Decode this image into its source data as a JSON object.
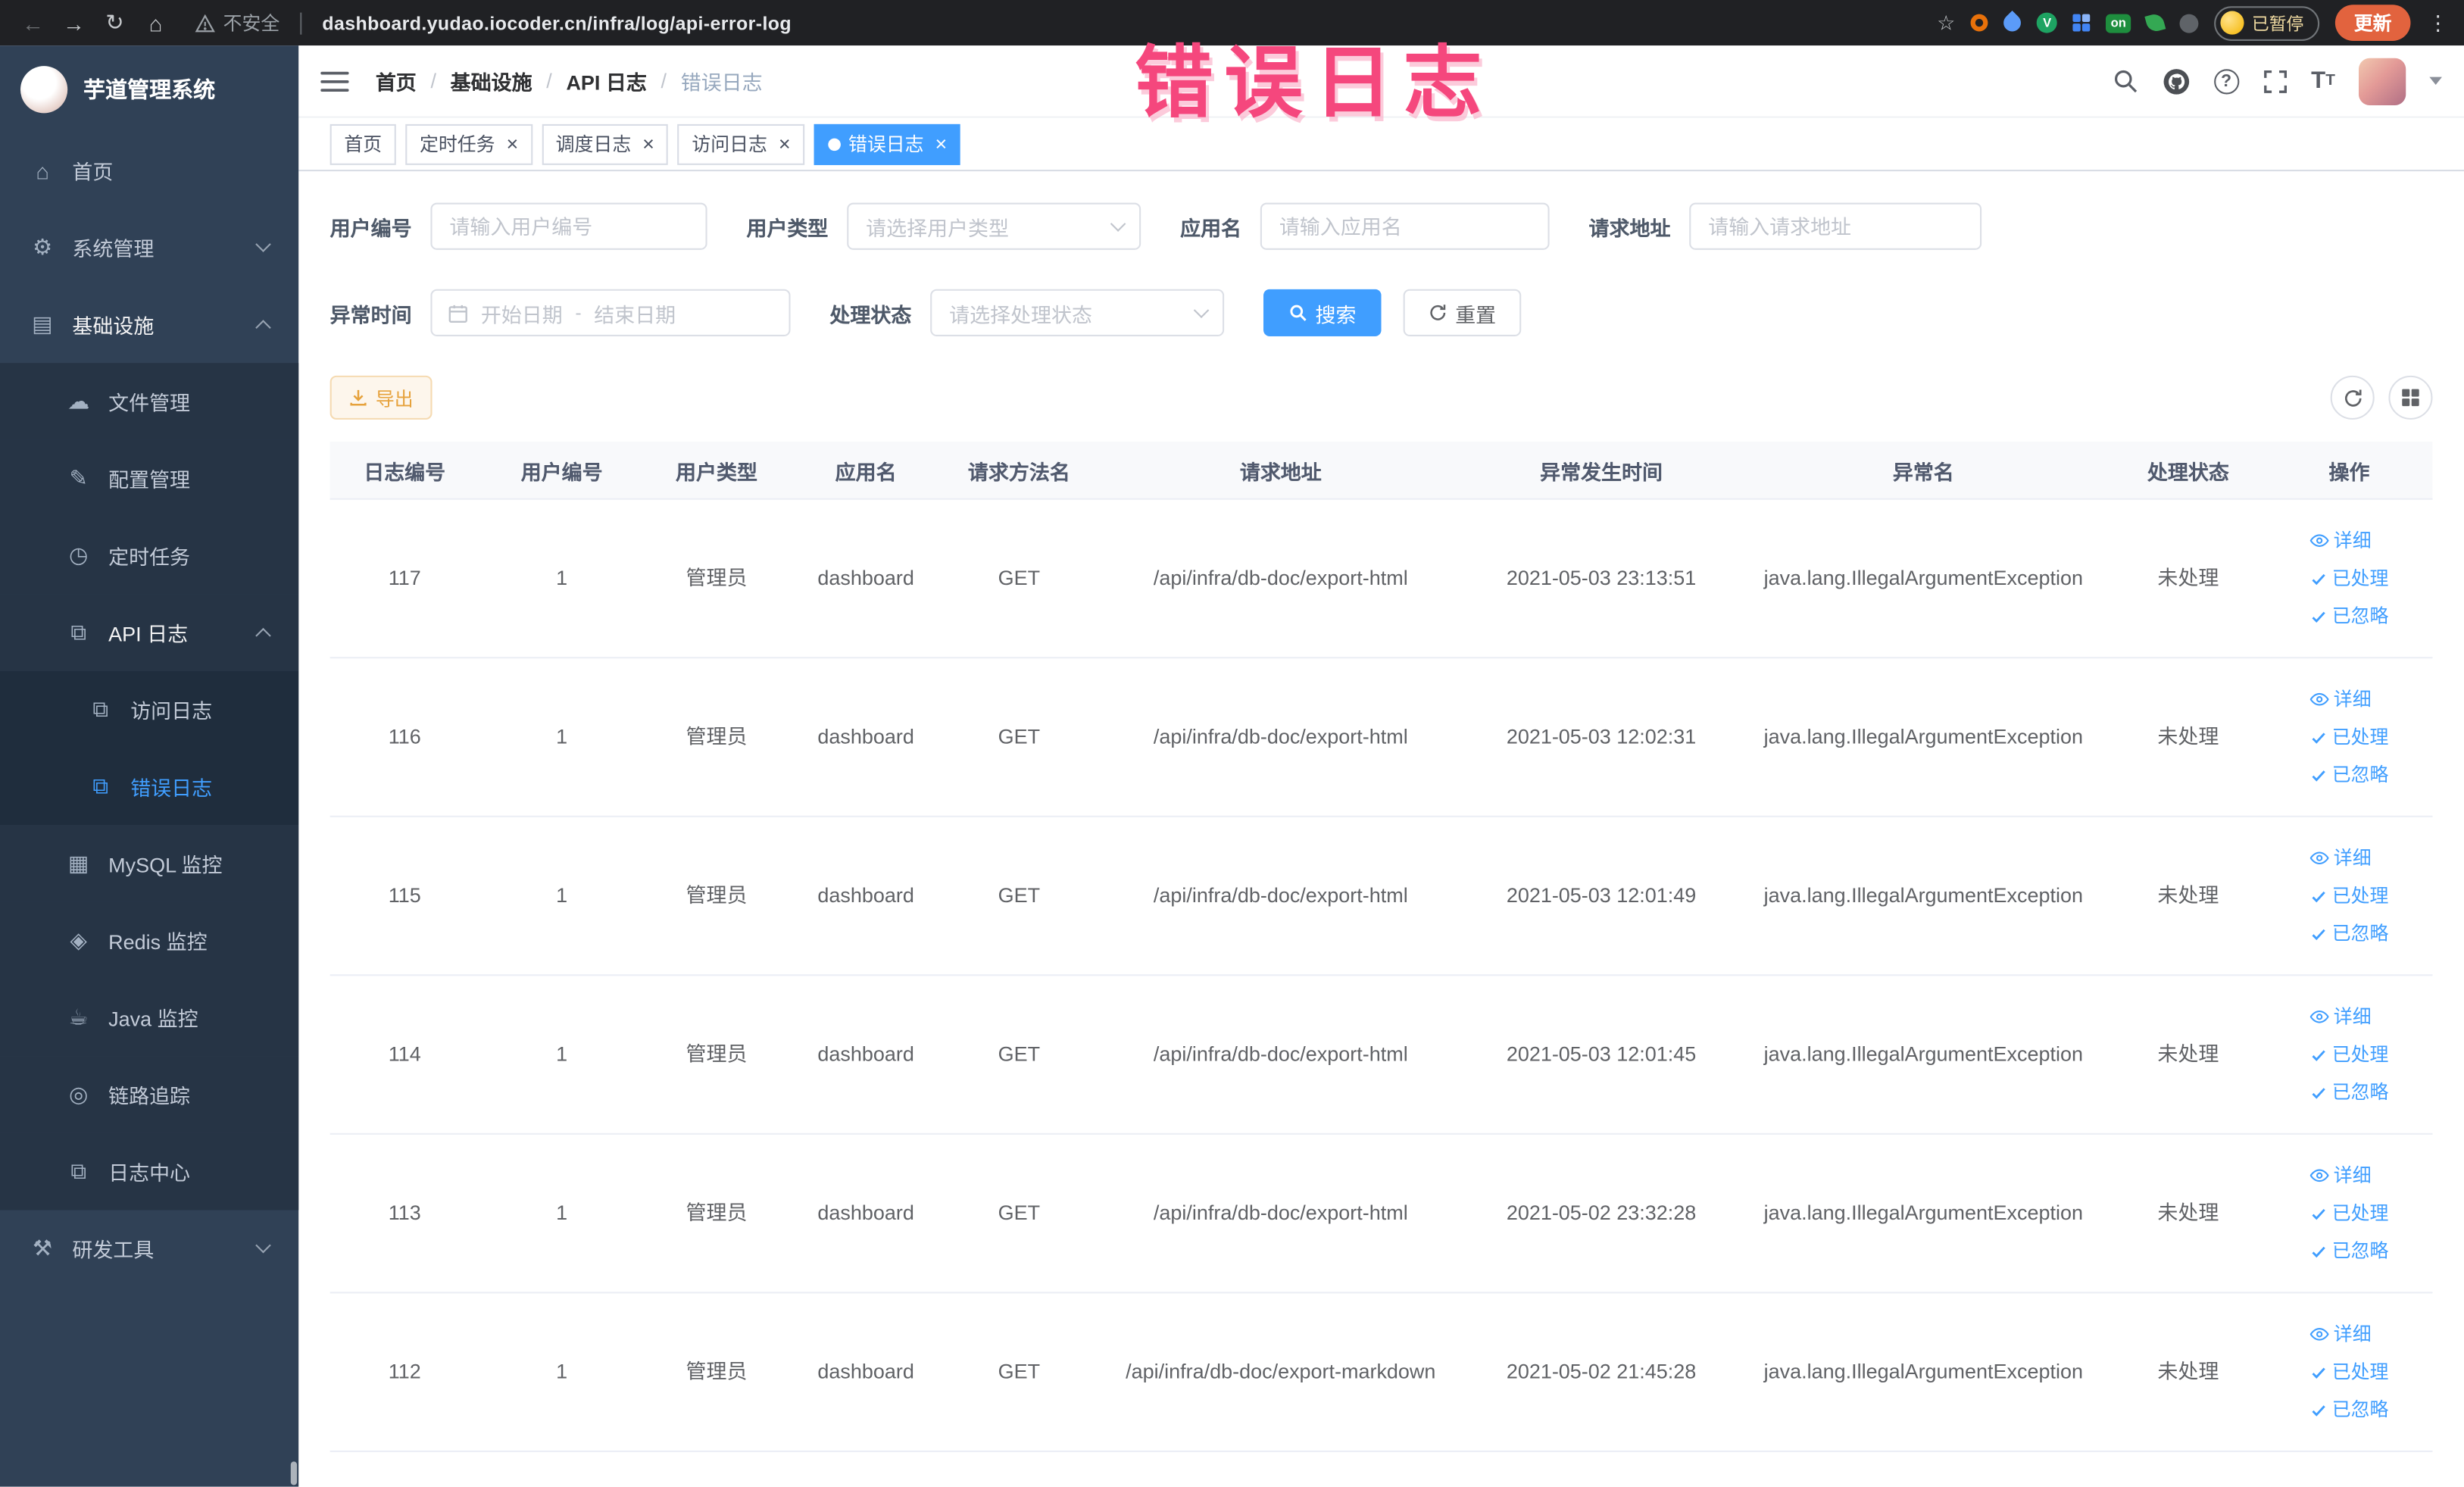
{
  "annotation": {
    "text": "错误日志"
  },
  "browser": {
    "security_label": "不安全",
    "url": "dashboard.yudao.iocoder.cn/infra/log/api-error-log",
    "on_badge": "on",
    "ext_v_label": "V",
    "paused_chip": "已暂停",
    "update_button": "更新"
  },
  "sidebar": {
    "logo_title": "芋道管理系统",
    "items": [
      {
        "name": "home",
        "label": "首页",
        "icon": "home-icon",
        "level": 1
      },
      {
        "name": "system-management",
        "label": "系统管理",
        "icon": "gear-icon",
        "level": 1,
        "arrow": "down"
      },
      {
        "name": "infrastructure",
        "label": "基础设施",
        "icon": "infra-icon",
        "level": 1,
        "arrow": "up",
        "open": true
      },
      {
        "name": "file-management",
        "label": "文件管理",
        "icon": "file-icon",
        "level": 2
      },
      {
        "name": "config-management",
        "label": "配置管理",
        "icon": "config-icon",
        "level": 2
      },
      {
        "name": "scheduled-jobs",
        "label": "定时任务",
        "icon": "job-icon",
        "level": 2
      },
      {
        "name": "api-logs",
        "label": "API 日志",
        "icon": "api-log-icon",
        "level": 2,
        "arrow": "up",
        "open": true
      },
      {
        "name": "access-log",
        "label": "访问日志",
        "icon": "doc-icon",
        "level": 3
      },
      {
        "name": "error-log",
        "label": "错误日志",
        "icon": "doc-icon",
        "level": 3,
        "active": true
      },
      {
        "name": "mysql-monitor",
        "label": "MySQL 监控",
        "icon": "mysql-icon",
        "level": 2
      },
      {
        "name": "redis-monitor",
        "label": "Redis 监控",
        "icon": "redis-icon",
        "level": 2
      },
      {
        "name": "java-monitor",
        "label": "Java 监控",
        "icon": "java-icon",
        "level": 2
      },
      {
        "name": "link-trace",
        "label": "链路追踪",
        "icon": "trace-icon",
        "level": 2
      },
      {
        "name": "log-center",
        "label": "日志中心",
        "icon": "log-center-icon",
        "level": 2
      },
      {
        "name": "dev-tools",
        "label": "研发工具",
        "icon": "tools-icon",
        "level": 1,
        "arrow": "down"
      }
    ]
  },
  "header": {
    "breadcrumb": [
      "首页",
      "基础设施",
      "API 日志",
      "错误日志"
    ]
  },
  "tabs": [
    {
      "label": "首页",
      "closable": false,
      "active": false
    },
    {
      "label": "定时任务",
      "closable": true,
      "active": false
    },
    {
      "label": "调度日志",
      "closable": true,
      "active": false
    },
    {
      "label": "访问日志",
      "closable": true,
      "active": false
    },
    {
      "label": "错误日志",
      "closable": true,
      "active": true
    }
  ],
  "filters": {
    "user_id": {
      "label": "用户编号",
      "placeholder": "请输入用户编号",
      "value": ""
    },
    "user_type": {
      "label": "用户类型",
      "placeholder": "请选择用户类型"
    },
    "app_name": {
      "label": "应用名",
      "placeholder": "请输入应用名",
      "value": ""
    },
    "request_url": {
      "label": "请求地址",
      "placeholder": "请输入请求地址",
      "value": ""
    },
    "exception_time": {
      "label": "异常时间",
      "start_placeholder": "开始日期",
      "separator": "-",
      "end_placeholder": "结束日期"
    },
    "process_status": {
      "label": "处理状态",
      "placeholder": "请选择处理状态"
    },
    "search_button": "搜索",
    "reset_button": "重置"
  },
  "toolbar": {
    "export_button": "导出"
  },
  "table": {
    "columns": [
      "日志编号",
      "用户编号",
      "用户类型",
      "应用名",
      "请求方法名",
      "请求地址",
      "异常发生时间",
      "异常名",
      "处理状态",
      "操作"
    ],
    "row_actions": [
      "详细",
      "已处理",
      "已忽略"
    ],
    "rows": [
      {
        "log_id": "117",
        "user_id": "1",
        "user_type": "管理员",
        "app_name": "dashboard",
        "method": "GET",
        "request_url": "/api/infra/db-doc/export-html",
        "time": "2021-05-03 23:13:51",
        "exception": "java.lang.IllegalArgumentException",
        "status": "未处理"
      },
      {
        "log_id": "116",
        "user_id": "1",
        "user_type": "管理员",
        "app_name": "dashboard",
        "method": "GET",
        "request_url": "/api/infra/db-doc/export-html",
        "time": "2021-05-03 12:02:31",
        "exception": "java.lang.IllegalArgumentException",
        "status": "未处理"
      },
      {
        "log_id": "115",
        "user_id": "1",
        "user_type": "管理员",
        "app_name": "dashboard",
        "method": "GET",
        "request_url": "/api/infra/db-doc/export-html",
        "time": "2021-05-03 12:01:49",
        "exception": "java.lang.IllegalArgumentException",
        "status": "未处理"
      },
      {
        "log_id": "114",
        "user_id": "1",
        "user_type": "管理员",
        "app_name": "dashboard",
        "method": "GET",
        "request_url": "/api/infra/db-doc/export-html",
        "time": "2021-05-03 12:01:45",
        "exception": "java.lang.IllegalArgumentException",
        "status": "未处理"
      },
      {
        "log_id": "113",
        "user_id": "1",
        "user_type": "管理员",
        "app_name": "dashboard",
        "method": "GET",
        "request_url": "/api/infra/db-doc/export-html",
        "time": "2021-05-02 23:32:28",
        "exception": "java.lang.IllegalArgumentException",
        "status": "未处理"
      },
      {
        "log_id": "112",
        "user_id": "1",
        "user_type": "管理员",
        "app_name": "dashboard",
        "method": "GET",
        "request_url": "/api/infra/db-doc/export-markdown",
        "time": "2021-05-02 21:45:28",
        "exception": "java.lang.IllegalArgumentException",
        "status": "未处理"
      }
    ]
  }
}
